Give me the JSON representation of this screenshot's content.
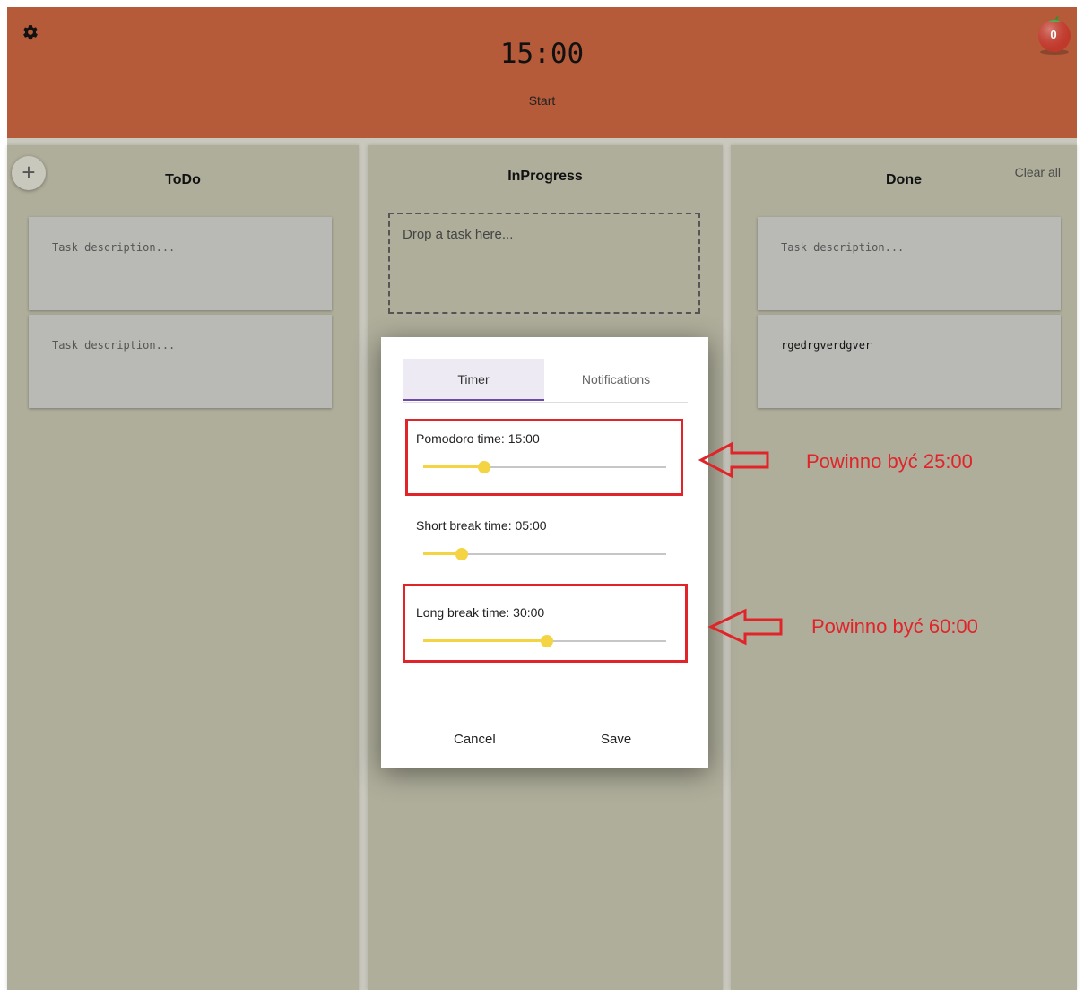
{
  "header": {
    "timer": "15:00",
    "start_label": "Start",
    "tomato_count": "0",
    "color": "#b55b3a"
  },
  "columns": {
    "todo": {
      "title": "ToDo",
      "add_icon": "plus-icon",
      "cards": [
        "Task description...",
        "Task description..."
      ]
    },
    "inprogress": {
      "title": "InProgress",
      "drop_placeholder": "Drop a task here..."
    },
    "done": {
      "title": "Done",
      "clear_all": "Clear all",
      "cards": [
        "Task description...",
        "rgedrgverdgver"
      ]
    }
  },
  "dialog": {
    "tabs": [
      "Timer",
      "Notifications"
    ],
    "active_tab": "Timer",
    "settings": [
      {
        "label": "Pomodoro time: 15:00",
        "value_fraction": 0.25
      },
      {
        "label": "Short break time: 05:00",
        "value_fraction": 0.16
      },
      {
        "label": "Long break time: 30:00",
        "value_fraction": 0.51
      }
    ],
    "cancel_label": "Cancel",
    "save_label": "Save"
  },
  "annotations": [
    {
      "text": "Powinno być 25:00"
    },
    {
      "text": "Powinno być 60:00"
    }
  ],
  "colors": {
    "column_bg": "#afae9b",
    "slider": "#f5d443",
    "tab_indicator": "#6d4aa8",
    "annotation": "#e0242a"
  }
}
